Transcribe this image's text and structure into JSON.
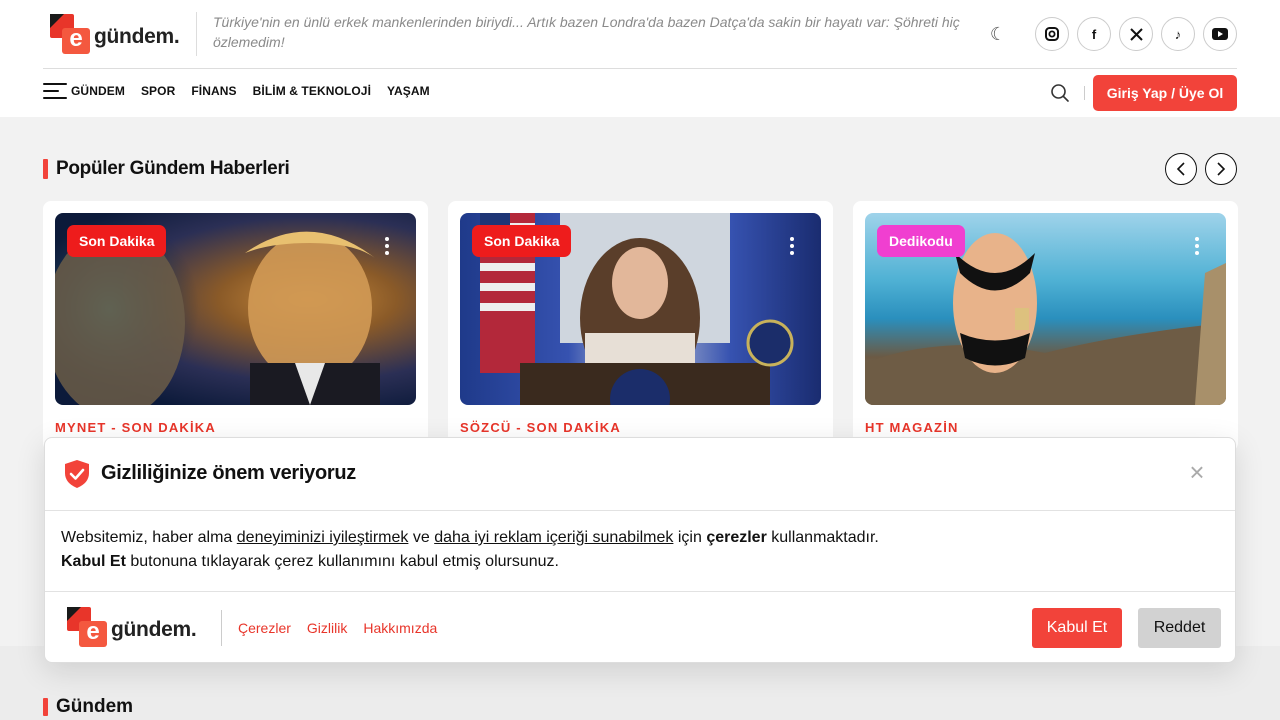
{
  "header": {
    "logo_text": "gündem.",
    "logo_letter": "e",
    "tagline": "Türkiye'nin en ünlü erkek mankenlerinden biriydi... Artık bazen Londra'da bazen Datça'da sakin bir hayatı var: Şöhreti hiç özlemedim!",
    "theme_icon": "moon-icon",
    "socials": [
      {
        "icon": "instagram-icon",
        "glyph": "◎"
      },
      {
        "icon": "facebook-icon",
        "glyph": "f"
      },
      {
        "icon": "x-twitter-icon",
        "glyph": "𝕏"
      },
      {
        "icon": "tiktok-icon",
        "glyph": "♪"
      },
      {
        "icon": "youtube-icon",
        "glyph": "▶"
      }
    ],
    "login_label": "Giriş Yap / Üye Ol"
  },
  "nav": {
    "items": [
      "GÜNDEM",
      "SPOR",
      "FİNANS",
      "BİLİM & TEKNOLOJİ",
      "YAŞAM"
    ]
  },
  "popular": {
    "title": "Popüler Gündem Haberleri",
    "prev": "‹",
    "next": "›",
    "cards": [
      {
        "badge": "Son Dakika",
        "badge_color": "#ee1c1c",
        "source": "MYNET - SON DAKİKA"
      },
      {
        "badge": "Son Dakika",
        "badge_color": "#ee1c1c",
        "source": "SÖZCÜ - SON DAKİKA"
      },
      {
        "badge": "Dedikodu",
        "badge_color": "#f03fd0",
        "source": "HT MAGAZİN"
      }
    ]
  },
  "section2": {
    "title": "Gündem"
  },
  "cookie": {
    "title": "Gizliliğinize önem veriyoruz",
    "close": "×",
    "line1_a": "Websitemiz, haber alma ",
    "line1_link1": "deneyiminizi iyileştirmek",
    "line1_b": " ve ",
    "line1_link2": "daha iyi reklam içeriği sunabilmek",
    "line1_c": " için ",
    "line1_bold": "çerezler",
    "line1_d": " kullanmaktadır.",
    "line2_bold": "Kabul Et",
    "line2_rest": " butonuna tıklayarak çerez kullanımını kabul etmiş olursunuz.",
    "links": [
      "Çerezler",
      "Gizlilik",
      "Hakkımızda"
    ],
    "accept": "Kabul Et",
    "reject": "Reddet"
  },
  "colors": {
    "accent": "#f2433a",
    "badge_red": "#ee1c1c",
    "badge_pink": "#f03fd0"
  }
}
